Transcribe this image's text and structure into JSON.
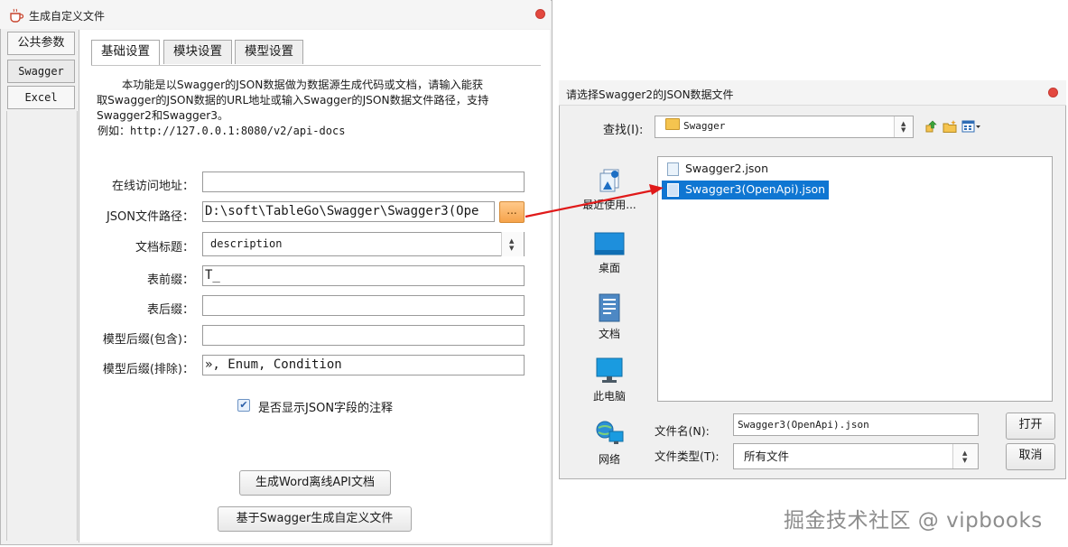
{
  "main_window": {
    "title": "生成自定义文件",
    "side_tabs": [
      "公共参数",
      "Swagger",
      "Excel"
    ],
    "top_tabs": [
      "基础设置",
      "模块设置",
      "模型设置"
    ],
    "intro_lines": [
      "本功能是以Swagger的JSON数据做为数据源生成代码或文档，请输入能获",
      "取Swagger的JSON数据的URL地址或输入Swagger的JSON数据文件路径，支持",
      "Swagger2和Swagger3。"
    ],
    "example": "例如：http://127.0.0.1:8080/v2/api-docs",
    "fields": {
      "online_url_label": "在线访问地址：",
      "online_url_value": "",
      "json_path_label": "JSON文件路径：",
      "json_path_value": "D:\\soft\\TableGo\\Swagger\\Swagger3(Ope",
      "browse_label": "...",
      "doc_title_label": "文档标题：",
      "doc_title_value": "description",
      "table_prefix_label": "表前缀：",
      "table_prefix_value": "T_",
      "table_suffix_label": "表后缀：",
      "table_suffix_value": "",
      "model_suffix_include_label": "模型后缀(包含)：",
      "model_suffix_include_value": "",
      "model_suffix_exclude_label": "模型后缀(排除)：",
      "model_suffix_exclude_value": "», Enum, Condition"
    },
    "checkbox_label": "是否显示JSON字段的注释",
    "checkbox_checked": true,
    "buttons": {
      "generate_word": "生成Word离线API文档",
      "generate_custom": "基于Swagger生成自定义文件"
    }
  },
  "dialog": {
    "title": "请选择Swagger2的JSON数据文件",
    "look_in_label": "查找(I):",
    "look_in_value": "Swagger",
    "places": [
      "最近使用...",
      "桌面",
      "文档",
      "此电脑",
      "网络"
    ],
    "files": [
      "Swagger2.json",
      "Swagger3(OpenApi).json"
    ],
    "selected_file_index": 1,
    "filename_label": "文件名(N):",
    "filename_value": "Swagger3(OpenApi).json",
    "filetype_label": "文件类型(T):",
    "filetype_value": "所有文件",
    "open_button": "打开",
    "cancel_button": "取消"
  },
  "watermark": "掘金技术社区 @ vipbooks",
  "colors": {
    "selection": "#0f76d2",
    "arrow": "#e01a1a",
    "close": "#e3483f",
    "browse": "#f6a34b"
  }
}
